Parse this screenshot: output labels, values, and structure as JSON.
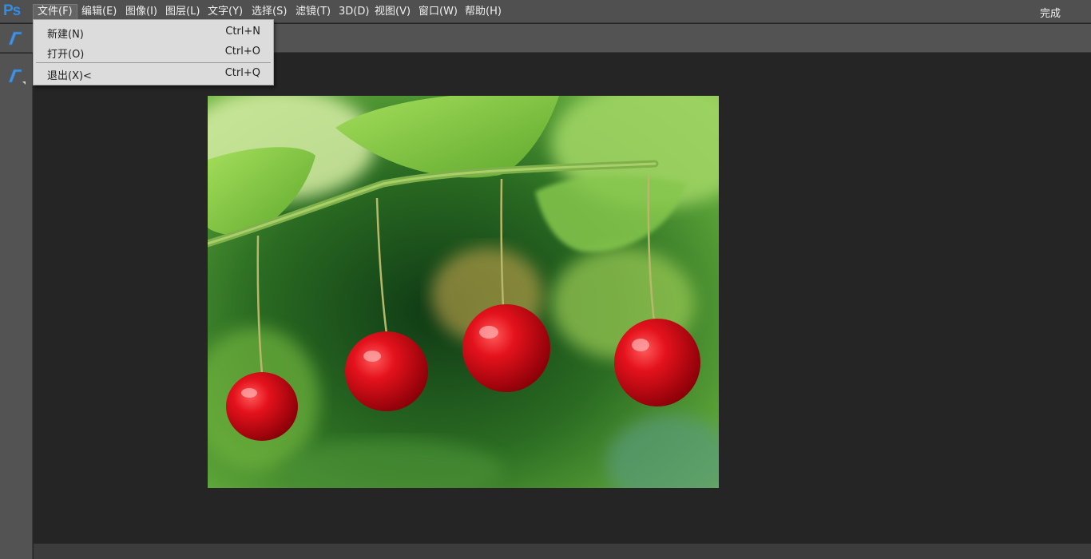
{
  "app": {
    "logo": "Ps"
  },
  "menubar": {
    "items": [
      "文件(F)",
      "编辑(E)",
      "图像(I)",
      "图层(L)",
      "文字(Y)",
      "选择(S)",
      "滤镜(T)",
      "3D(D)",
      "视图(V)",
      "窗口(W)",
      "帮助(H)"
    ],
    "active_index": 0,
    "done_label": "完成"
  },
  "file_menu": {
    "items": [
      {
        "label": "新建(N)",
        "shortcut": "Ctrl+N"
      },
      {
        "label": "打开(O)",
        "shortcut": "Ctrl+O"
      },
      {
        "label": "退出(X)<",
        "shortcut": "Ctrl+Q"
      }
    ]
  },
  "tools": {
    "options_icon": "type-tool-icon",
    "active_tool_icon": "type-tool-icon"
  },
  "colors": {
    "ps_blue": "#2f8fe8",
    "menubar_bg": "#505050",
    "panel_bg": "#535353",
    "workspace_bg": "#252525",
    "dropdown_bg": "#dcdcdc"
  },
  "canvas": {
    "content": "cherries-photo"
  }
}
